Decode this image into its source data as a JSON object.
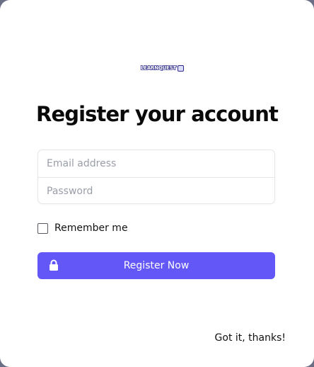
{
  "logo": {
    "text": "LEARNQUEST"
  },
  "title": "Register your account",
  "form": {
    "email_placeholder": "Email address",
    "password_placeholder": "Password",
    "remember_label": "Remember me",
    "remember_checked": false
  },
  "register_button": {
    "label": "Register Now",
    "icon": "lock-icon"
  },
  "dismiss_link": "Got it, thanks!",
  "colors": {
    "accent": "#6457f7",
    "background": "#ffffff",
    "overlay": "#6b6f86"
  }
}
